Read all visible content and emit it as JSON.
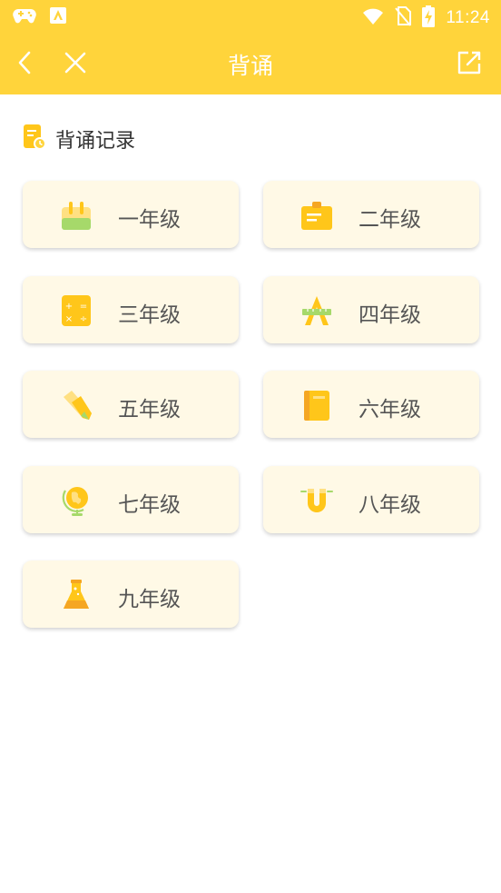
{
  "status_bar": {
    "time": "11:24",
    "icons": [
      "gamepad-icon",
      "app-icon",
      "wifi-icon",
      "no-sim-icon",
      "battery-charging-icon"
    ]
  },
  "app_bar": {
    "title": "背诵",
    "back_icon": "chevron-left-icon",
    "close_icon": "close-icon",
    "share_icon": "share-icon"
  },
  "record": {
    "label": "背诵记录",
    "icon": "record-icon"
  },
  "grades": [
    {
      "label": "一年级",
      "icon": "backpack-icon"
    },
    {
      "label": "二年级",
      "icon": "folder-icon"
    },
    {
      "label": "三年级",
      "icon": "calculator-icon"
    },
    {
      "label": "四年级",
      "icon": "compass-icon"
    },
    {
      "label": "五年级",
      "icon": "pencil-icon"
    },
    {
      "label": "六年级",
      "icon": "book-icon"
    },
    {
      "label": "七年级",
      "icon": "globe-icon"
    },
    {
      "label": "八年级",
      "icon": "magnet-icon"
    },
    {
      "label": "九年级",
      "icon": "flask-icon"
    }
  ],
  "colors": {
    "accent": "#FFD43B",
    "card_bg": "#FFF9E6",
    "icon_yellow": "#FFC61A",
    "icon_green": "#A6D96A"
  }
}
